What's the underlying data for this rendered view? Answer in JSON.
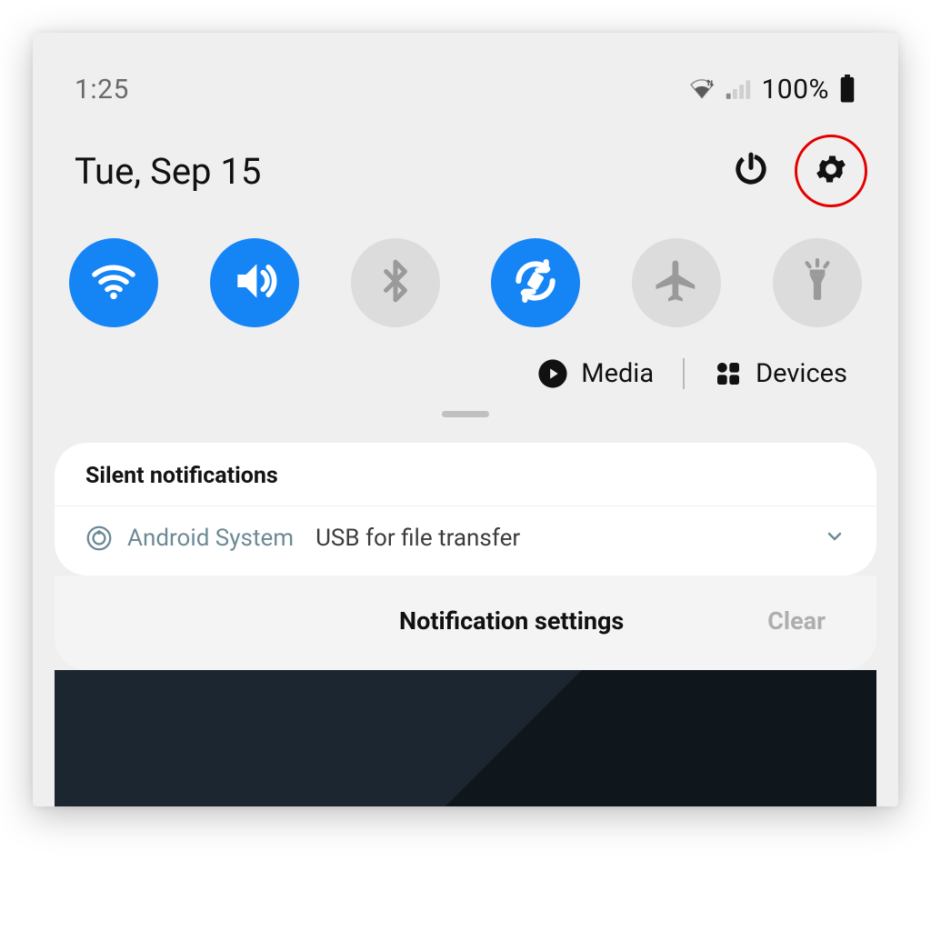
{
  "status": {
    "time": "1:25",
    "battery_pct": "100%"
  },
  "date": "Tue, Sep 15",
  "shortcuts": {
    "media": "Media",
    "devices": "Devices"
  },
  "notifications": {
    "section_title": "Silent notifications",
    "items": [
      {
        "app": "Android System",
        "title": "USB for file transfer"
      }
    ]
  },
  "footer": {
    "settings": "Notification settings",
    "clear": "Clear"
  }
}
